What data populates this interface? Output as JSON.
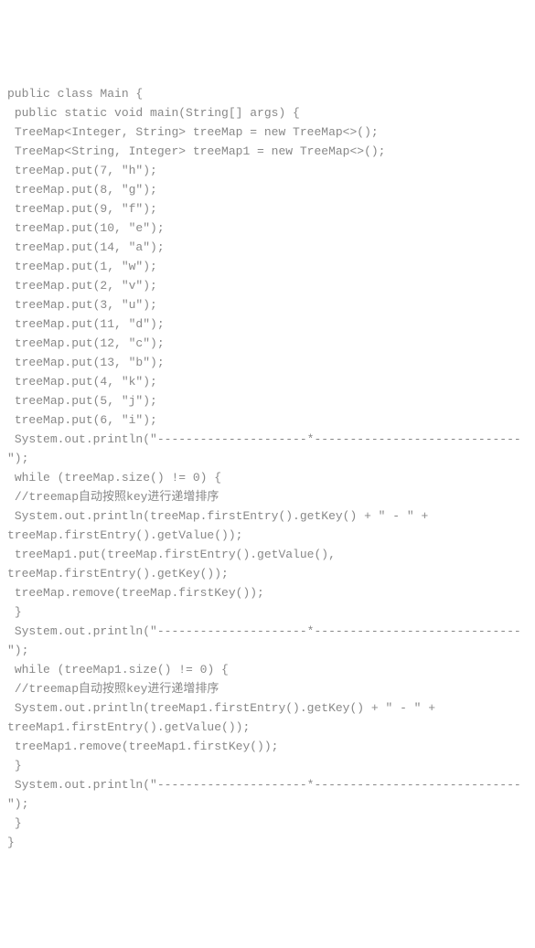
{
  "code_lines": [
    "public class Main {",
    " public static void main(String[] args) {",
    " TreeMap<Integer, String> treeMap = new TreeMap<>();",
    " TreeMap<String, Integer> treeMap1 = new TreeMap<>();",
    " treeMap.put(7, \"h\");",
    " treeMap.put(8, \"g\");",
    " treeMap.put(9, \"f\");",
    " treeMap.put(10, \"e\");",
    " treeMap.put(14, \"a\");",
    " treeMap.put(1, \"w\");",
    " treeMap.put(2, \"v\");",
    " treeMap.put(3, \"u\");",
    " treeMap.put(11, \"d\");",
    " treeMap.put(12, \"c\");",
    " treeMap.put(13, \"b\");",
    " treeMap.put(4, \"k\");",
    " treeMap.put(5, \"j\");",
    " treeMap.put(6, \"i\");",
    " System.out.println(\"---------------------*-----------------------------\");",
    " while (treeMap.size() != 0) {",
    " //treemap自动按照key进行递增排序",
    " System.out.println(treeMap.firstEntry().getKey() + \" - \" + treeMap.firstEntry().getValue());",
    " treeMap1.put(treeMap.firstEntry().getValue(), treeMap.firstEntry().getKey());",
    " treeMap.remove(treeMap.firstKey());",
    " }",
    " System.out.println(\"---------------------*-----------------------------\");",
    " while (treeMap1.size() != 0) {",
    " //treemap自动按照key进行递增排序",
    " System.out.println(treeMap1.firstEntry().getKey() + \" - \" + treeMap1.firstEntry().getValue());",
    " treeMap1.remove(treeMap1.firstKey());",
    " }",
    " System.out.println(\"---------------------*-----------------------------\");",
    " }",
    "}"
  ]
}
